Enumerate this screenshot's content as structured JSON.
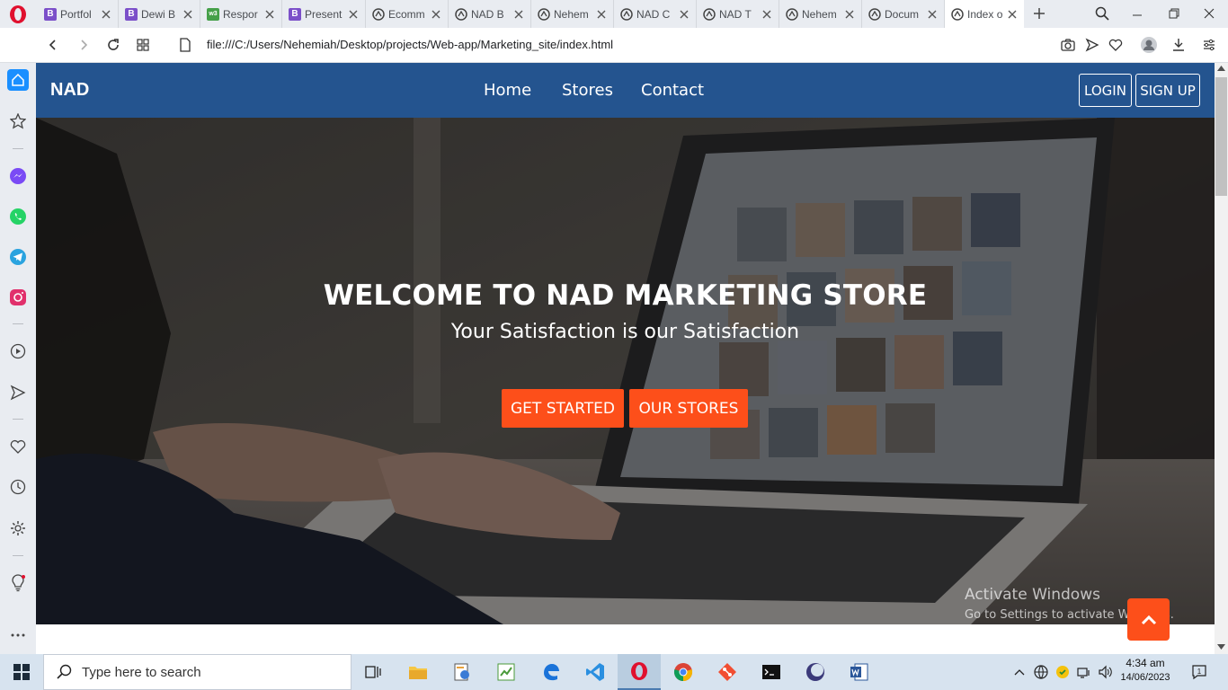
{
  "browser": {
    "tabs": [
      {
        "title": "Portfol",
        "favicon": "bootstrap-icon",
        "active": false
      },
      {
        "title": "Dewi B",
        "favicon": "bootstrap-icon",
        "active": false
      },
      {
        "title": "Respor",
        "favicon": "w3schools-icon",
        "active": false
      },
      {
        "title": "Present",
        "favicon": "bootstrap-icon",
        "active": false
      },
      {
        "title": "Ecomm",
        "favicon": "globe-icon",
        "active": false
      },
      {
        "title": "NAD B",
        "favicon": "globe-icon",
        "active": false
      },
      {
        "title": "Nehem",
        "favicon": "globe-icon",
        "active": false
      },
      {
        "title": "NAD C",
        "favicon": "globe-icon",
        "active": false
      },
      {
        "title": "NAD T",
        "favicon": "globe-icon",
        "active": false
      },
      {
        "title": "Nehem",
        "favicon": "globe-icon",
        "active": false
      },
      {
        "title": "Docum",
        "favicon": "globe-icon",
        "active": false
      },
      {
        "title": "Index o",
        "favicon": "globe-icon",
        "active": true
      }
    ],
    "url": "file:///C:/Users/Nehemiah/Desktop/projects/Web-app/Marketing_site/index.html"
  },
  "site": {
    "brand": "NAD",
    "nav": {
      "home": "Home",
      "stores": "Stores",
      "contact": "Contact",
      "login": "LOGIN",
      "signup": "SIGN UP"
    },
    "hero": {
      "title": "WELCOME TO NAD MARKETING STORE",
      "subtitle": "Your Satisfaction is our Satisfaction",
      "cta_primary": "GET STARTED",
      "cta_secondary": "OUR STORES"
    },
    "colors": {
      "nav_bg": "#24548f",
      "accent": "#fd4f1a"
    }
  },
  "watermark": {
    "title": "Activate Windows",
    "subtitle": "Go to Settings to activate Windows."
  },
  "taskbar": {
    "search_placeholder": "Type here to search",
    "time": "4:34 am",
    "date": "14/06/2023"
  }
}
